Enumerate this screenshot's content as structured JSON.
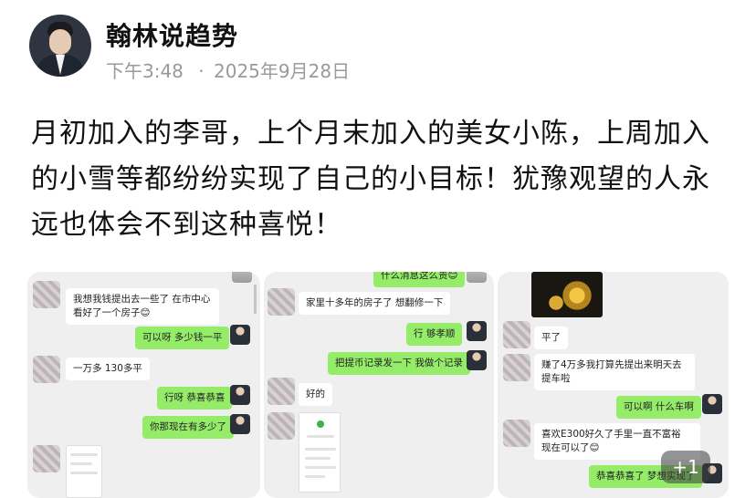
{
  "author": {
    "name": "翰林说趋势"
  },
  "meta": {
    "time": "下午3:48",
    "separator": "·",
    "date": "2025年9月28日"
  },
  "post": {
    "text": "月初加入的李哥，上个月末加入的美女小陈，上周加入的小雪等都纷纷实现了自己的小目标！犹豫观望的人永远也体会不到这种喜悦！"
  },
  "screenshots": {
    "s1": {
      "msg1": "我想我钱提出去一些了 在市中心看好了一个房子😊",
      "msg2": "可以呀 多少钱一平",
      "msg3": "一万多 130多平",
      "msg4": "行呀 恭喜恭喜",
      "msg5": "你那现在有多少了"
    },
    "s2": {
      "msg0": "什么消息这么贵😊",
      "msg1": "家里十多年的房子了 想翻修一下",
      "msg2": "行 够孝顺",
      "msg3": "把提币记录发一下 我做个记录",
      "msg4": "好的"
    },
    "s3": {
      "msg1": "平了",
      "msg2": "赚了4万多我打算先提出来明天去提车啦",
      "msg3": "可以啊 什么车啊",
      "msg4": "喜欢E300好久了手里一直不富裕 现在可以了😊",
      "msg5": "恭喜恭喜了 梦想实现了"
    }
  },
  "more_count": "+1"
}
